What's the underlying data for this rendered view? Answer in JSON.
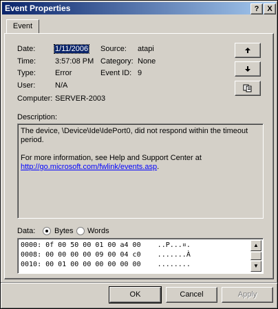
{
  "window": {
    "title": "Event Properties"
  },
  "titlebar_buttons": {
    "help": "?",
    "close": "X"
  },
  "tabs": [
    {
      "label": "Event"
    }
  ],
  "event": {
    "date_label": "Date:",
    "date": "1/11/2006",
    "source_label": "Source:",
    "source": "atapi",
    "time_label": "Time:",
    "time": "3:57:08 PM",
    "category_label": "Category:",
    "category": "None",
    "type_label": "Type:",
    "type": "Error",
    "eventid_label": "Event ID:",
    "eventid": "9",
    "user_label": "User:",
    "user": "N/A",
    "computer_label": "Computer:",
    "computer": "SERVER-2003"
  },
  "side_buttons": [
    "up-arrow-icon",
    "down-arrow-icon",
    "copy-icon"
  ],
  "description": {
    "label": "Description:",
    "line1": "The device, \\Device\\Ide\\IdePort0, did not respond within the timeout period.",
    "line2": "For more information, see Help and Support Center at",
    "link": "http://go.microsoft.com/fwlink/events.asp",
    "link_suffix": "."
  },
  "data": {
    "label": "Data:",
    "bytes_label": "Bytes",
    "words_label": "Words",
    "selected": "Bytes",
    "rows": [
      "0000: 0f 00 50 00 01 00 a4 00    ..P...¤.",
      "0008: 00 00 00 00 09 00 04 c0    .......À",
      "0010: 00 01 00 00 00 00 00 00    ........"
    ]
  },
  "buttons": {
    "ok": "OK",
    "cancel": "Cancel",
    "apply": "Apply"
  }
}
